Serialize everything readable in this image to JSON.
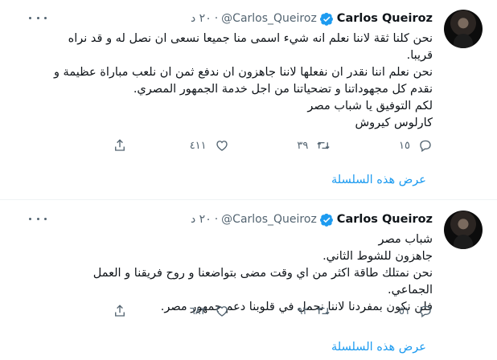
{
  "colors": {
    "accent": "#1d9bf0",
    "secondary_text": "#536471",
    "text": "#0f1419",
    "verified": "#1d9bf0"
  },
  "tweets": [
    {
      "author": {
        "name": "Carlos Queiroz",
        "handle": "@Carlos_Queiroz",
        "verified": true
      },
      "timestamp": "٢٠ د",
      "separator": "·",
      "text_lines": [
        "نحن كلنا ثقة لاننا نعلم انه شيء اسمى منا جميعا نسعى ان نصل له و قد نراه قريبا.",
        "نحن نعلم اننا نقدر ان نفعلها لاننا جاهزون ان ندفع ثمن ان نلعب مباراة عظيمة و نقدم كل مجهوداتنا و تضحياتنا من اجل خدمة الجمهور المصري.",
        "لكم التوفيق يا شباب مصر",
        "كارلوس كيروش"
      ],
      "actions": {
        "reply_count": "١٥",
        "retweet_count": "٣٩",
        "like_count": "٤١١"
      },
      "thread_link_label": "عرض هذه السلسلة",
      "icons": [
        "more-icon",
        "verified-badge-icon",
        "reply-icon",
        "retweet-icon",
        "like-icon",
        "share-icon"
      ]
    },
    {
      "author": {
        "name": "Carlos Queiroz",
        "handle": "@Carlos_Queiroz",
        "verified": true
      },
      "timestamp": "٢٠ د",
      "separator": "·",
      "text_lines": [
        "شباب مصر",
        "جاهزون للشوط الثاني.",
        "نحن نمتلك طاقة اكثر من اي وقت مضى بتواضعنا و روح فريقنا و العمل الجماعي.",
        "فلن نكون بمفردنا لاننا نحمل في قلوبنا دعم جمهور مصر."
      ],
      "actions": {
        "reply_count": "٥١",
        "retweet_count": "٩٢",
        "like_count": "٦٨٢"
      },
      "thread_link_label": "عرض هذه السلسلة",
      "icons": [
        "more-icon",
        "verified-badge-icon",
        "reply-icon",
        "retweet-icon",
        "like-icon",
        "share-icon"
      ]
    }
  ]
}
